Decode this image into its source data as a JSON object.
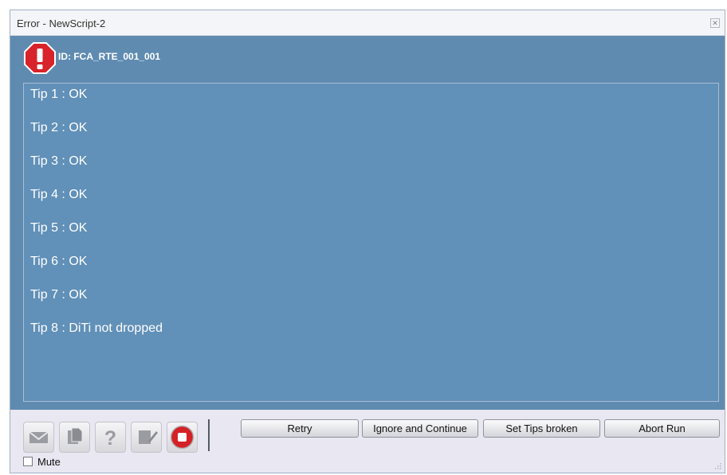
{
  "window": {
    "title": "Error - NewScript-2",
    "close_icon": "close-icon"
  },
  "header": {
    "error_icon": "error-octagon-icon",
    "error_id": "ID: FCA_RTE_001_001"
  },
  "message": {
    "lines": [
      "Tip 1 : OK",
      "Tip 2 : OK",
      "Tip 3 : OK",
      "Tip 4 : OK",
      "Tip 5 : OK",
      "Tip 6 : OK",
      "Tip 7 : OK",
      "Tip 8 : DiTi not dropped"
    ]
  },
  "toolbar": {
    "icons": [
      "mail-icon",
      "copy-icon",
      "help-icon",
      "edit-icon",
      "stop-icon"
    ],
    "buttons": {
      "retry": "Retry",
      "ignore": "Ignore and Continue",
      "set_tips_broken": "Set Tips broken",
      "abort": "Abort Run"
    },
    "mute_label": "Mute",
    "mute_checked": false
  },
  "colors": {
    "panel_background": "#5f8bb1",
    "error_red": "#d8232a"
  }
}
